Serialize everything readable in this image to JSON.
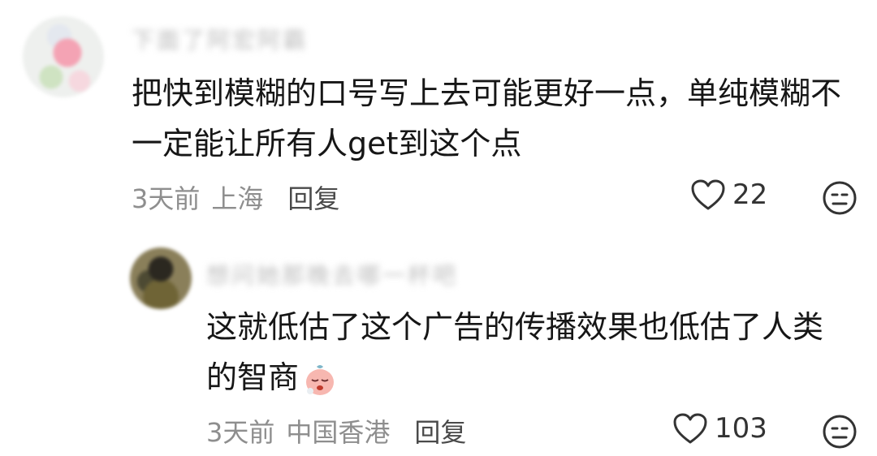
{
  "comments": [
    {
      "username": "下面了阿宏阿霸",
      "text": "把快到模糊的口号写上去可能更好一点，单纯模糊不一定能让所有人get到这个点",
      "time": "3天前",
      "location": "上海",
      "reply_label": "回复",
      "likes": "22"
    },
    {
      "username": "想问她那晚去哪一杯吧",
      "text": "这就低估了这个广告的传播效果也低估了人类的智商",
      "time": "3天前",
      "location": "中国香港",
      "reply_label": "回复",
      "likes": "103"
    }
  ],
  "icons": {
    "like": "heart-outline-icon",
    "dislike": "meh-face-icon",
    "emoji": "crying-face-emoji"
  },
  "colors": {
    "text": "#161616",
    "meta": "#8e8e8e",
    "reply": "#4a4a4a"
  }
}
